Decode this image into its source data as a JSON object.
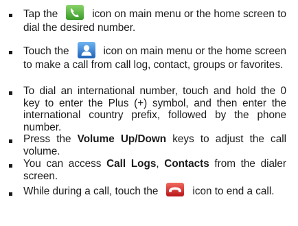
{
  "items": [
    {
      "pre": "Tap the",
      "icon": "phone-dialer-icon",
      "post": "icon on main menu or the home screen to dial the desired number."
    },
    {
      "pre": "Touch the",
      "icon": "contacts-person-icon",
      "post": "icon on main menu or the home screen to make a call from call log, contact, groups or favorites."
    },
    {
      "text": "To dial an international number, touch and hold the 0 key to enter the Plus (+) symbol, and then enter the international country prefix, followed by the phone number."
    },
    {
      "pre": "Press the",
      "bold": "Volume Up/Down",
      "post": "keys to adjust the call volume."
    },
    {
      "pre": "You can access",
      "bold1": "Call Logs",
      "sep": ",",
      "bold2": "Contacts",
      "post": "from the dialer screen."
    },
    {
      "pre": "While during a call, touch the",
      "icon": "end-call-icon",
      "post": "icon to end a call."
    }
  ],
  "colors": {
    "dialer_icon_bg": "#4caf3a",
    "contacts_icon_bg": "#2f7fd6",
    "end_call_icon_bg": "#d8262a"
  }
}
